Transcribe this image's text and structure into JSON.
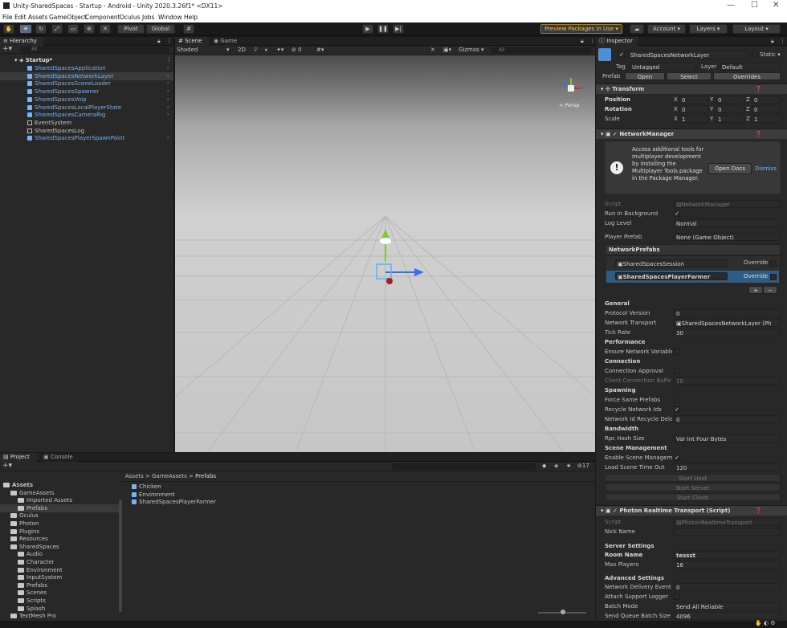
{
  "window": {
    "title": "Unity-SharedSpaces - Startup - Android - Unity 2020.3.26f1* <DX11>",
    "min": "—",
    "max": "☐",
    "close": "✕"
  },
  "menu": [
    "File",
    "Edit",
    "Assets",
    "GameObject",
    "Component",
    "Oculus",
    "Jobs",
    "Window",
    "Help"
  ],
  "toolbar": {
    "pivot": "Pivot",
    "global": "Global",
    "preview": "Preview Packages in Use ▾",
    "account": "Account ▾",
    "layers": "Layers ▾",
    "layout": "Layout ▾"
  },
  "hierarchy": {
    "tab": "Hierarchy",
    "search": "All",
    "scene": "Startup*",
    "items": [
      {
        "label": "SharedSpacesApplication",
        "blue": true
      },
      {
        "label": "SharedSpacesNetworkLayer",
        "blue": true,
        "selected": true
      },
      {
        "label": "SharedSpacesSceneLoader",
        "blue": true
      },
      {
        "label": "SharedSpacesSpawner",
        "blue": true
      },
      {
        "label": "SharedSpacesVoip",
        "blue": true
      },
      {
        "label": "SharedSpacesLocalPlayerState",
        "blue": true
      },
      {
        "label": "SharedSpacesCameraRig",
        "blue": true
      },
      {
        "label": "EventSystem",
        "blue": false
      },
      {
        "label": "SharedSpacesLog",
        "blue": false
      },
      {
        "label": "SharedSpacesPlayerSpawnPoint",
        "blue": true
      }
    ]
  },
  "scene": {
    "tab_scene": "Scene",
    "tab_game": "Game",
    "shading": "Shaded",
    "mode2d": "2D",
    "gizmos": "Gizmos ▾",
    "search": "All",
    "persp": "< Persp",
    "count": "0"
  },
  "project": {
    "tab_project": "Project",
    "tab_console": "Console",
    "count": "17",
    "breadcrumb": [
      "Assets",
      "GameAssets",
      "Prefabs"
    ],
    "tree": [
      {
        "label": "Assets",
        "indent": 0,
        "bold": true
      },
      {
        "label": "GameAssets",
        "indent": 1
      },
      {
        "label": "Imported Assets",
        "indent": 2
      },
      {
        "label": "Prefabs",
        "indent": 2,
        "selected": true
      },
      {
        "label": "Oculus",
        "indent": 1
      },
      {
        "label": "Photon",
        "indent": 1
      },
      {
        "label": "Plugins",
        "indent": 1
      },
      {
        "label": "Resources",
        "indent": 1
      },
      {
        "label": "SharedSpaces",
        "indent": 1
      },
      {
        "label": "Audio",
        "indent": 2
      },
      {
        "label": "Character",
        "indent": 2
      },
      {
        "label": "Environment",
        "indent": 2
      },
      {
        "label": "InputSystem",
        "indent": 2
      },
      {
        "label": "Prefabs",
        "indent": 2
      },
      {
        "label": "Scenes",
        "indent": 2
      },
      {
        "label": "Scripts",
        "indent": 2
      },
      {
        "label": "Splash",
        "indent": 2
      },
      {
        "label": "TextMesh Pro",
        "indent": 1
      }
    ],
    "files": [
      "Chicken",
      "Environment",
      "SharedSpacesPlayerFarmer"
    ]
  },
  "inspector": {
    "tab": "Inspector",
    "object_name": "SharedSpacesNetworkLayer",
    "static": "Static ▾",
    "tag_label": "Tag",
    "tag": "Untagged",
    "layer_label": "Layer",
    "layer": "Default",
    "prefab_label": "Prefab",
    "open": "Open",
    "select": "Select",
    "overrides": "Overrides",
    "transform": {
      "title": "Transform",
      "position": "Position",
      "rotation": "Rotation",
      "scale": "Scale",
      "pos": [
        "0",
        "0",
        "0"
      ],
      "rot": [
        "0",
        "0",
        "0"
      ],
      "scl": [
        "1",
        "1",
        "1"
      ]
    },
    "netman": {
      "title": "NetworkManager",
      "info": "Access additional tools for multiplayer development by installing the Multiplayer Tools package in the Package Manager.",
      "open_docs": "Open Docs",
      "dismiss": "Dismiss",
      "script_label": "Script",
      "script": "NetworkManager",
      "run_bg": "Run In Background",
      "log_level": "Log Level",
      "log_value": "Normal",
      "player_prefab": "Player Prefab",
      "player_prefab_value": "None (Game Object)",
      "prefabs_header": "NetworkPrefabs",
      "prefab1": "SharedSpacesSession",
      "prefab2": "SharedSpacesPlayerFarmer",
      "override": "Override",
      "general": "General",
      "protocol": "Protocol Version",
      "protocol_v": "0",
      "transport": "Network Transport",
      "transport_v": "SharedSpacesNetworkLayer (Ph",
      "tick": "Tick Rate",
      "tick_v": "30",
      "performance": "Performance",
      "ensure": "Ensure Network Variable",
      "connection": "Connection",
      "approval": "Connection Approval",
      "client_buf": "Client Connection Buffe",
      "client_buf_v": "10",
      "spawning": "Spawning",
      "force_same": "Force Same Prefabs",
      "recycle": "Recycle Network Ids",
      "recycle_delay": "Network Id Recycle Dela",
      "recycle_delay_v": "0",
      "bandwidth": "Bandwidth",
      "rpc": "Rpc Hash Size",
      "rpc_v": "Var Int Four Bytes",
      "scene_mgmt": "Scene Management",
      "enable_scene": "Enable Scene Managem",
      "load_timeout": "Load Scene Time Out",
      "load_timeout_v": "120",
      "start_host": "Start Host",
      "start_server": "Start Server",
      "start_client": "Start Client"
    },
    "photon": {
      "title": "Photon Realtime Transport (Script)",
      "script_label": "Script",
      "script": "PhotonRealtimeTransport",
      "nick": "Nick Name",
      "server": "Server Settings",
      "room": "Room Name",
      "room_v": "tessst",
      "max_players": "Max Players",
      "max_players_v": "16",
      "advanced": "Advanced Settings",
      "delivery": "Network Delivery Event",
      "delivery_v": "0",
      "attach": "Attach Support Logger",
      "batch": "Batch Mode",
      "batch_v": "Send All Reliable",
      "queue": "Send Queue Batch Size",
      "queue_v": "4096"
    }
  }
}
